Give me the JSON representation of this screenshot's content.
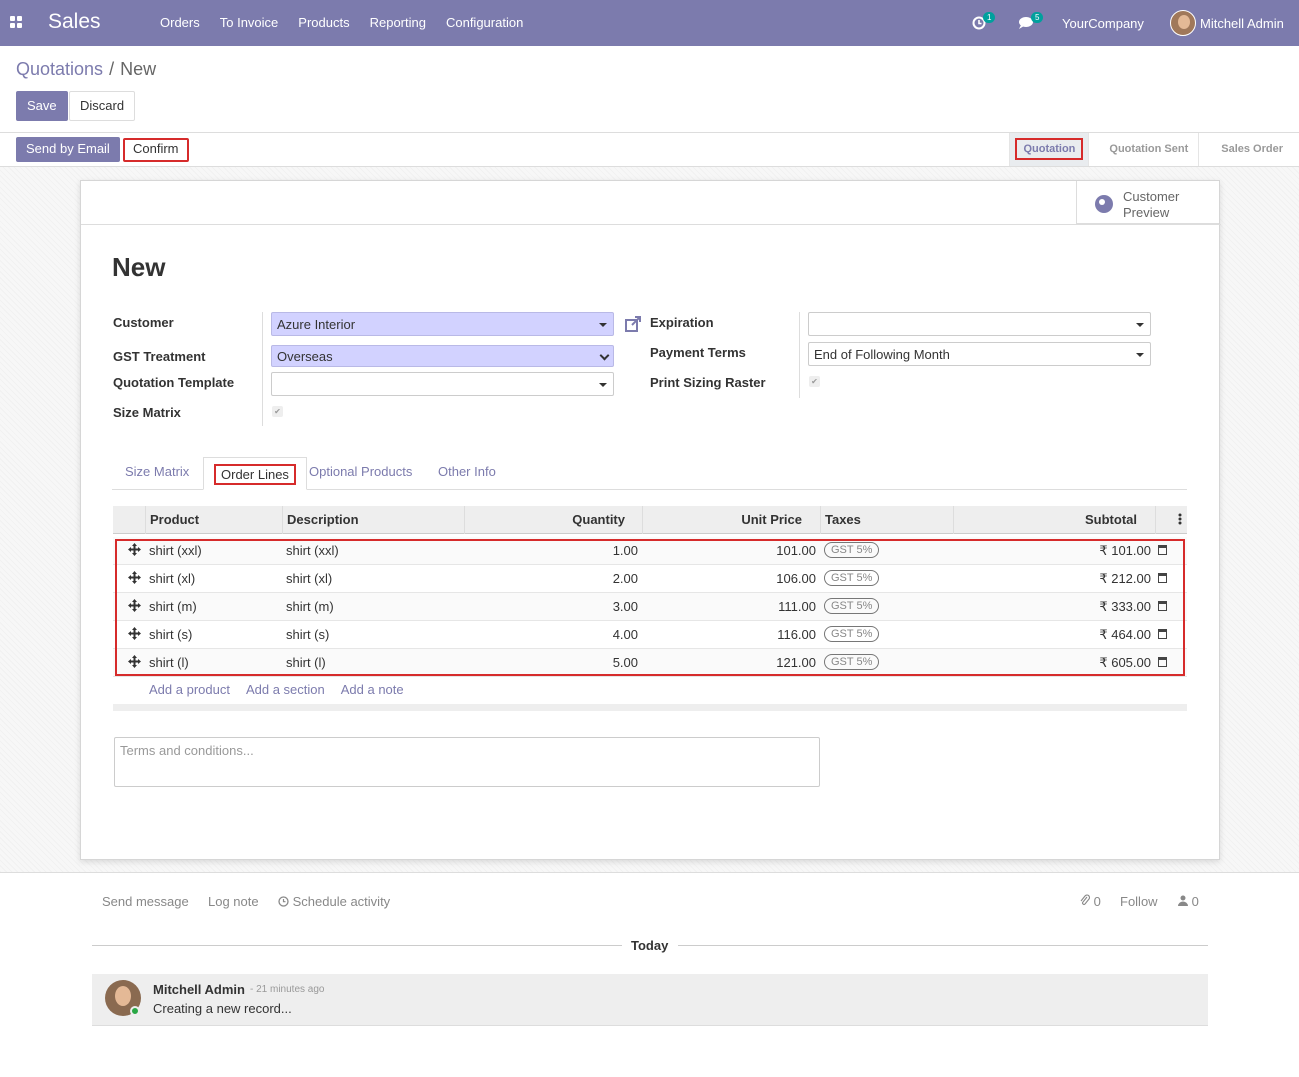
{
  "navbar": {
    "app_name": "Sales",
    "menu": [
      "Orders",
      "To Invoice",
      "Products",
      "Reporting",
      "Configuration"
    ],
    "activity_count": "1",
    "message_count": "5",
    "company": "YourCompany",
    "user": "Mitchell Admin"
  },
  "breadcrumb": {
    "parent": "Quotations",
    "sep": "/",
    "current": "New"
  },
  "actions": {
    "save": "Save",
    "discard": "Discard"
  },
  "statusbar": {
    "send_email": "Send by Email",
    "confirm": "Confirm",
    "stages": [
      "Quotation",
      "Quotation Sent",
      "Sales Order"
    ],
    "active_stage": "Quotation"
  },
  "smart_button": {
    "line1": "Customer",
    "line2": "Preview"
  },
  "form": {
    "title": "New",
    "labels": {
      "customer": "Customer",
      "gst": "GST Treatment",
      "template": "Quotation Template",
      "size_matrix": "Size Matrix",
      "expiration": "Expiration",
      "payment_terms": "Payment Terms",
      "print_raster": "Print Sizing Raster"
    },
    "values": {
      "customer": "Azure Interior",
      "gst": "Overseas",
      "template": "",
      "expiration": "",
      "payment_terms": "End of Following Month",
      "size_matrix_checked": true,
      "print_raster_checked": true
    }
  },
  "tabs": [
    "Size Matrix",
    "Order Lines",
    "Optional Products",
    "Other Info"
  ],
  "active_tab": "Order Lines",
  "table": {
    "columns": [
      "Product",
      "Description",
      "Quantity",
      "Unit Price",
      "Taxes",
      "Subtotal"
    ],
    "rows": [
      {
        "product": "shirt (xxl)",
        "description": "shirt (xxl)",
        "quantity": "1.00",
        "price": "101.00",
        "tax": "GST 5%",
        "subtotal": "₹ 101.00"
      },
      {
        "product": "shirt (xl)",
        "description": "shirt (xl)",
        "quantity": "2.00",
        "price": "106.00",
        "tax": "GST 5%",
        "subtotal": "₹ 212.00"
      },
      {
        "product": "shirt (m)",
        "description": "shirt (m)",
        "quantity": "3.00",
        "price": "111.00",
        "tax": "GST 5%",
        "subtotal": "₹ 333.00"
      },
      {
        "product": "shirt (s)",
        "description": "shirt (s)",
        "quantity": "4.00",
        "price": "116.00",
        "tax": "GST 5%",
        "subtotal": "₹ 464.00"
      },
      {
        "product": "shirt (l)",
        "description": "shirt (l)",
        "quantity": "5.00",
        "price": "121.00",
        "tax": "GST 5%",
        "subtotal": "₹ 605.00"
      }
    ],
    "add_links": [
      "Add a product",
      "Add a section",
      "Add a note"
    ]
  },
  "terms_placeholder": "Terms and conditions...",
  "chatter": {
    "send_message": "Send message",
    "log_note": "Log note",
    "schedule": "Schedule activity",
    "attachments": "0",
    "follow": "Follow",
    "followers": "0",
    "today": "Today",
    "message": {
      "author": "Mitchell Admin",
      "time": "- 21 minutes ago",
      "body": "Creating a new record..."
    }
  },
  "colors": {
    "brand": "#7c7bad",
    "highlight": "#d62b2b",
    "required": "#d2d2ff"
  }
}
